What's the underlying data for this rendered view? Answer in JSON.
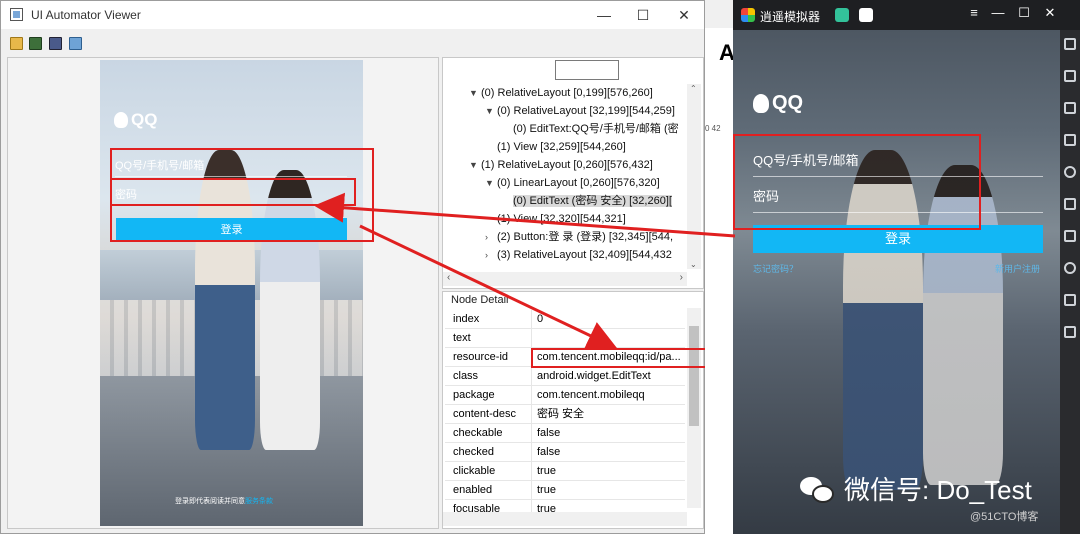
{
  "uia": {
    "title": "UI Automator Viewer",
    "controls": {
      "minimize": "—",
      "maximize": "☐",
      "close": "✕"
    }
  },
  "phone_left": {
    "logo": "QQ",
    "username_placeholder": "QQ号/手机号/邮箱",
    "password_placeholder": "密码",
    "login_button": "登录",
    "footer_text": "登录即代表阅读并同意",
    "footer_link": "服务条款"
  },
  "hierarchy": {
    "rows": [
      {
        "text": "(0) RelativeLayout [0,199][576,260]",
        "arrow": "▼",
        "indent": 1
      },
      {
        "text": "(0) RelativeLayout [32,199][544,259]",
        "arrow": "▼",
        "indent": 2
      },
      {
        "text": "(0) EditText:QQ号/手机号/邮箱 (密",
        "arrow": "",
        "indent": 3
      },
      {
        "text": "(1) View [32,259][544,260]",
        "arrow": "",
        "indent": 2
      },
      {
        "text": "(1) RelativeLayout [0,260][576,432]",
        "arrow": "▼",
        "indent": 1
      },
      {
        "text": "(0) LinearLayout [0,260][576,320]",
        "arrow": "▼",
        "indent": 2
      },
      {
        "text": "(0) EditText (密码 安全) [32,260][",
        "arrow": "",
        "indent": 3,
        "selected": true
      },
      {
        "text": "(1) View [32,320][544,321]",
        "arrow": "",
        "indent": 2
      },
      {
        "text": "(2) Button:登 录 (登录) [32,345][544,",
        "arrow": "›",
        "indent": 2
      },
      {
        "text": "(3) RelativeLayout [32,409][544,432",
        "arrow": "›",
        "indent": 2
      }
    ]
  },
  "details": {
    "header": "Node Detail",
    "rows": [
      {
        "key": "index",
        "value": "0"
      },
      {
        "key": "text",
        "value": ""
      },
      {
        "key": "resource-id",
        "value": "com.tencent.mobileqq:id/pa..."
      },
      {
        "key": "class",
        "value": "android.widget.EditText"
      },
      {
        "key": "package",
        "value": "com.tencent.mobileqq"
      },
      {
        "key": "content-desc",
        "value": "密码 安全"
      },
      {
        "key": "checkable",
        "value": "false"
      },
      {
        "key": "checked",
        "value": "false"
      },
      {
        "key": "clickable",
        "value": "true"
      },
      {
        "key": "enabled",
        "value": "true"
      },
      {
        "key": "focusable",
        "value": "true"
      }
    ]
  },
  "background_window": {
    "letter": "A",
    "numbers": "0   42"
  },
  "emulator": {
    "title": "逍遥模拟器",
    "controls": {
      "menu": "≡",
      "minimize": "—",
      "maximize": "☐",
      "close": "✕"
    },
    "logo": "QQ",
    "username_placeholder": "QQ号/手机号/邮箱",
    "password_placeholder": "密码",
    "login_button": "登录",
    "link_left": "忘记密码？",
    "link_right": "新用户注册"
  },
  "watermark": {
    "text": "微信号: Do_Test",
    "credit": "@51CTO博客"
  },
  "colors": {
    "accent": "#12b7f5",
    "highlight": "#e02020"
  }
}
